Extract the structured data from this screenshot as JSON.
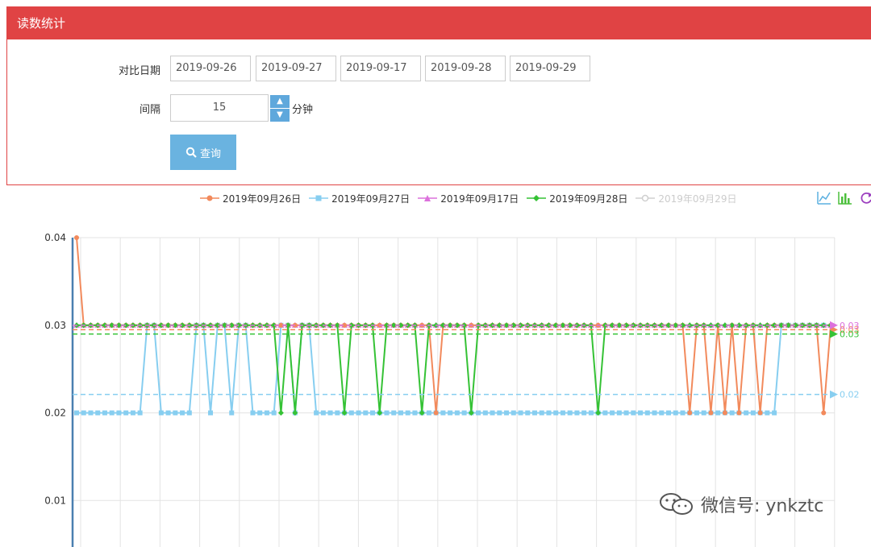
{
  "panel": {
    "title": "读数统计"
  },
  "form": {
    "compare_label": "对比日期",
    "dates": [
      "2019-09-26",
      "2019-09-27",
      "2019-09-17",
      "2019-09-28",
      "2019-09-29"
    ],
    "interval_label": "间隔",
    "interval_value": "15",
    "interval_unit": "分钟",
    "query_label": "查询"
  },
  "toolbox": {
    "icons": [
      "line-chart-icon",
      "bar-chart-icon",
      "refresh-icon"
    ]
  },
  "watermark": {
    "text": "微信号: ynkztc"
  },
  "colors": {
    "header": "#e04344",
    "s1": "#f28a5c",
    "s2": "#87cef0",
    "s3": "#dc71dc",
    "s4": "#35c235",
    "s5": "#cfcfcf"
  },
  "chart_data": {
    "type": "line",
    "ylim": [
      0,
      0.04
    ],
    "y_ticks": [
      "0.04",
      "0.03",
      "0.02",
      "0.01"
    ],
    "series": [
      {
        "name": "2019年09月26日",
        "color": "#f28a5c",
        "marker": "circle",
        "values": [
          0.04,
          0.03,
          0.03,
          0.03,
          0.03,
          0.03,
          0.03,
          0.03,
          0.03,
          0.03,
          0.03,
          0.03,
          0.03,
          0.03,
          0.03,
          0.03,
          0.03,
          0.03,
          0.03,
          0.03,
          0.03,
          0.03,
          0.03,
          0.03,
          0.03,
          0.03,
          0.03,
          0.03,
          0.03,
          0.03,
          0.03,
          0.03,
          0.03,
          0.03,
          0.03,
          0.03,
          0.03,
          0.03,
          0.03,
          0.03,
          0.03,
          0.03,
          0.03,
          0.03,
          0.03,
          0.03,
          0.03,
          0.03,
          0.03,
          0.03,
          0.03,
          0.02,
          0.03,
          0.03,
          0.03,
          0.03,
          0.03,
          0.03,
          0.03,
          0.03,
          0.03,
          0.03,
          0.03,
          0.03,
          0.03,
          0.03,
          0.03,
          0.03,
          0.03,
          0.03,
          0.03,
          0.03,
          0.03,
          0.03,
          0.03,
          0.03,
          0.03,
          0.03,
          0.03,
          0.03,
          0.03,
          0.03,
          0.03,
          0.03,
          0.03,
          0.03,
          0.03,
          0.02,
          0.03,
          0.03,
          0.02,
          0.03,
          0.02,
          0.03,
          0.02,
          0.03,
          0.03,
          0.02,
          0.03,
          0.03,
          0.03,
          0.03,
          0.03,
          0.03,
          0.03,
          0.03,
          0.02,
          0.03
        ],
        "avg": 0.0295,
        "avg_label": "0.03"
      },
      {
        "name": "2019年09月27日",
        "color": "#87cef0",
        "marker": "square",
        "values": [
          0.02,
          0.02,
          0.02,
          0.02,
          0.02,
          0.02,
          0.02,
          0.02,
          0.02,
          0.02,
          0.03,
          0.03,
          0.02,
          0.02,
          0.02,
          0.02,
          0.02,
          0.03,
          0.03,
          0.02,
          0.03,
          0.03,
          0.02,
          0.03,
          0.03,
          0.02,
          0.02,
          0.02,
          0.02,
          0.03,
          0.03,
          0.02,
          0.03,
          0.03,
          0.02,
          0.02,
          0.02,
          0.02,
          0.02,
          0.02,
          0.02,
          0.02,
          0.02,
          0.02,
          0.02,
          0.02,
          0.02,
          0.02,
          0.02,
          0.02,
          0.02,
          0.02,
          0.02,
          0.02,
          0.02,
          0.02,
          0.02,
          0.02,
          0.02,
          0.02,
          0.02,
          0.02,
          0.02,
          0.02,
          0.02,
          0.02,
          0.02,
          0.02,
          0.02,
          0.02,
          0.02,
          0.02,
          0.02,
          0.02,
          0.02,
          0.02,
          0.02,
          0.02,
          0.02,
          0.02,
          0.02,
          0.02,
          0.02,
          0.02,
          0.02,
          0.02,
          0.02,
          0.02,
          0.02,
          0.02,
          0.02,
          0.02,
          0.02,
          0.02,
          0.02,
          0.02,
          0.02,
          0.02,
          0.02,
          0.02,
          0.03,
          0.03,
          0.03,
          0.03,
          0.03,
          0.03,
          0.03
        ],
        "avg": 0.0221,
        "avg_label": "0.02"
      },
      {
        "name": "2019年09月17日",
        "color": "#dc71dc",
        "marker": "triangle",
        "values": [
          0.03,
          0.03,
          0.03,
          0.03,
          0.03,
          0.03,
          0.03,
          0.03,
          0.03,
          0.03,
          0.03,
          0.03,
          0.03,
          0.03,
          0.03,
          0.03,
          0.03,
          0.03,
          0.03,
          0.03,
          0.03,
          0.03,
          0.03,
          0.03,
          0.03,
          0.03,
          0.03,
          0.03,
          0.03,
          0.03,
          0.03,
          0.03,
          0.03,
          0.03,
          0.03,
          0.03,
          0.03,
          0.03,
          0.03,
          0.03,
          0.03,
          0.03,
          0.03,
          0.03,
          0.03,
          0.03,
          0.03,
          0.03,
          0.03,
          0.03,
          0.03,
          0.03,
          0.03,
          0.03,
          0.03,
          0.03,
          0.03,
          0.03,
          0.03,
          0.03,
          0.03,
          0.03,
          0.03,
          0.03,
          0.03,
          0.03,
          0.03,
          0.03,
          0.03,
          0.03,
          0.03,
          0.03,
          0.03,
          0.03,
          0.03,
          0.03,
          0.03,
          0.03,
          0.03,
          0.03,
          0.03,
          0.03,
          0.03,
          0.03,
          0.03,
          0.03,
          0.03,
          0.03,
          0.03,
          0.03,
          0.03,
          0.03,
          0.03,
          0.03,
          0.03,
          0.03,
          0.03,
          0.03,
          0.03,
          0.03,
          0.03,
          0.03,
          0.03,
          0.03,
          0.03,
          0.03,
          0.03,
          0.03
        ],
        "avg": 0.03,
        "avg_label": "0.03"
      },
      {
        "name": "2019年09月28日",
        "color": "#35c235",
        "marker": "diamond",
        "values": [
          0.03,
          0.03,
          0.03,
          0.03,
          0.03,
          0.03,
          0.03,
          0.03,
          0.03,
          0.03,
          0.03,
          0.03,
          0.03,
          0.03,
          0.03,
          0.03,
          0.03,
          0.03,
          0.03,
          0.03,
          0.03,
          0.03,
          0.03,
          0.03,
          0.03,
          0.03,
          0.03,
          0.03,
          0.03,
          0.02,
          0.03,
          0.02,
          0.03,
          0.03,
          0.03,
          0.03,
          0.03,
          0.03,
          0.02,
          0.03,
          0.03,
          0.03,
          0.03,
          0.02,
          0.03,
          0.03,
          0.03,
          0.03,
          0.03,
          0.02,
          0.03,
          0.03,
          0.03,
          0.03,
          0.03,
          0.03,
          0.02,
          0.03,
          0.03,
          0.03,
          0.03,
          0.03,
          0.03,
          0.03,
          0.03,
          0.03,
          0.03,
          0.03,
          0.03,
          0.03,
          0.03,
          0.03,
          0.03,
          0.03,
          0.02,
          0.03,
          0.03,
          0.03,
          0.03,
          0.03,
          0.03,
          0.03,
          0.03,
          0.03,
          0.03,
          0.03,
          0.03,
          0.03,
          0.03,
          0.03,
          0.03,
          0.03,
          0.03,
          0.03,
          0.03,
          0.03,
          0.03,
          0.03,
          0.03,
          0.03,
          0.03,
          0.03,
          0.03,
          0.03,
          0.03,
          0.03,
          0.03,
          0.03
        ],
        "avg": 0.029,
        "avg_label": "0.03"
      },
      {
        "name": "2019年09月29日",
        "color": "#cfcfcf",
        "marker": "circle-hollow",
        "values": [],
        "avg": null,
        "avg_label": ""
      }
    ]
  }
}
